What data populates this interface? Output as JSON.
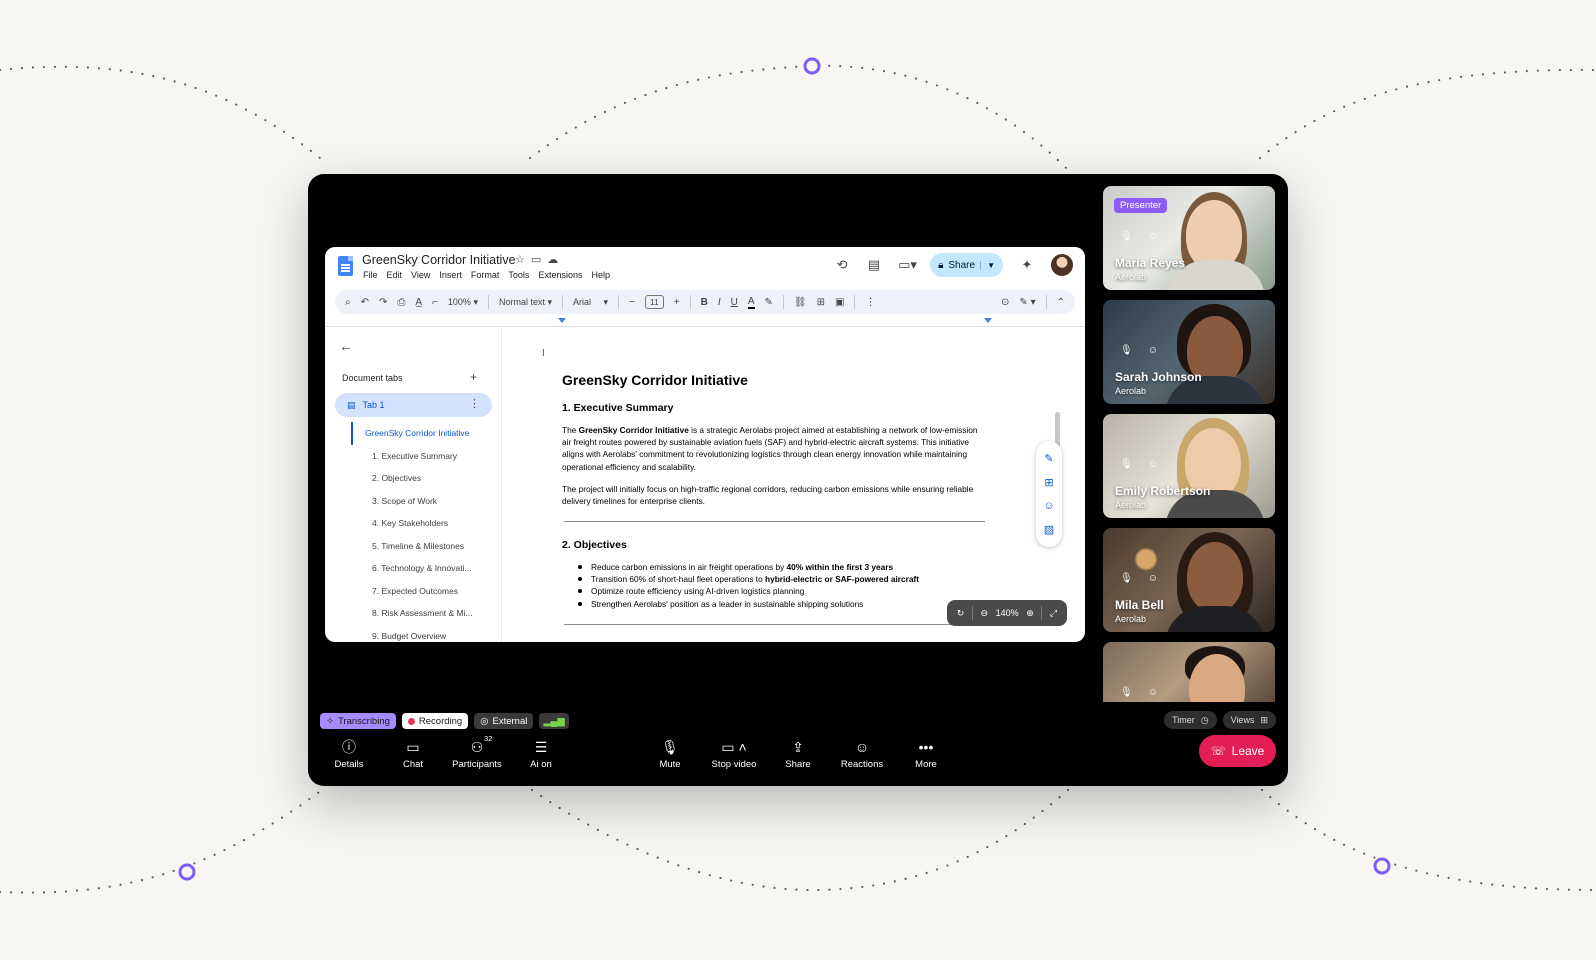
{
  "doc": {
    "title": "GreenSky Corridor Initiative",
    "menu": [
      "File",
      "Edit",
      "View",
      "Insert",
      "Format",
      "Tools",
      "Extensions",
      "Help"
    ],
    "share_label": "Share",
    "toolbar": {
      "zoom": "100%",
      "style": "Normal text",
      "font": "Arial",
      "font_size": "11"
    },
    "sidebar": {
      "title": "Document tabs",
      "tab_label": "Tab 1",
      "outline": [
        "GreenSky Corridor Initiative",
        "1. Executive Summary",
        "2. Objectives",
        "3. Scope of Work",
        "4. Key Stakeholders",
        "5. Timeline & Milestones",
        "6. Technology & Innovati...",
        "7. Expected Outcomes",
        "8. Risk Assessment & Mi...",
        "9. Budget Overview"
      ]
    },
    "content": {
      "h1": "GreenSky Corridor Initiative",
      "h2_exec": "1. Executive Summary",
      "p1_pre": "The ",
      "p1_bold": "GreenSky Corridor Initiative",
      "p1_post": " is a strategic Aerolabs project aimed at establishing a network of low-emission air freight routes powered by sustainable aviation fuels (SAF) and hybrid-electric aircraft systems. This initiative aligns with Aerolabs' commitment to revolutionizing logistics through clean energy innovation while maintaining operational efficiency and scalability.",
      "p2": "The project will initially focus on high-traffic regional corridors, reducing carbon emissions while ensuring reliable delivery timelines for enterprise clients.",
      "h2_obj": "2. Objectives",
      "b1_pre": "Reduce carbon emissions in air freight operations by ",
      "b1_bold": "40% within the first 3 years",
      "b2_pre": "Transition 60% of short-haul fleet operations to ",
      "b2_bold": "hybrid-electric or SAF-powered aircraft",
      "b3": "Optimize route efficiency using AI-driven logistics planning",
      "b4": "Strengthen Aerolabs' position as a leader in sustainable shipping solutions"
    },
    "zoom_level": "140%"
  },
  "participants": [
    {
      "name": "Maria Reyes",
      "org": "Aerolab",
      "badge": "Presenter"
    },
    {
      "name": "Sarah Johnson",
      "org": "Aerolab"
    },
    {
      "name": "Emily Robertson",
      "org": "Aerolab"
    },
    {
      "name": "Mila Bell",
      "org": "Aerolab"
    },
    {
      "name": "",
      "org": ""
    }
  ],
  "status": {
    "transcribing": "Transcribing",
    "recording": "Recording",
    "external": "External"
  },
  "right_controls": {
    "timer": "Timer",
    "views": "Views"
  },
  "controls": {
    "details": "Details",
    "chat": "Chat",
    "participants": "Participants",
    "participants_count": "32",
    "ai": "Ai on",
    "mute": "Mute",
    "stop_video": "Stop video",
    "share": "Share",
    "reactions": "Reactions",
    "more": "More",
    "leave": "Leave"
  },
  "colors": {
    "accent_purple": "#7c5cf5",
    "leave_red": "#e31e54",
    "share_blue": "#c2e7ff",
    "doc_blue": "#0b57d0"
  }
}
